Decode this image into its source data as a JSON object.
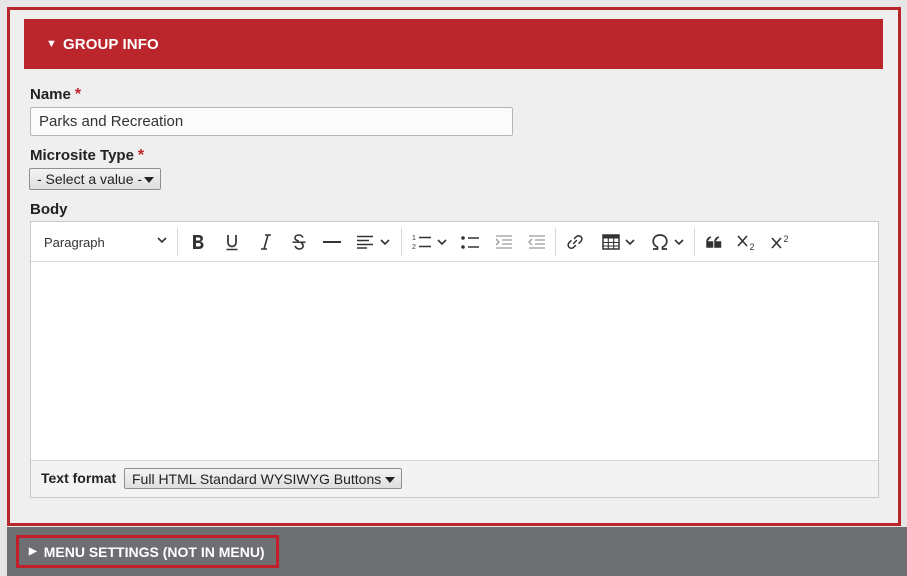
{
  "group_info": {
    "toggle_icon": "triangle-down",
    "title": "GROUP INFO"
  },
  "name_field": {
    "label": "Name",
    "required_mark": "*",
    "value": "Parks and Recreation"
  },
  "microsite_type": {
    "label": "Microsite Type",
    "required_mark": "*",
    "selected": "- Select a value -"
  },
  "body_field": {
    "label": "Body",
    "toolbar": {
      "heading_dropdown": "Paragraph",
      "buttons": [
        "bold",
        "underline",
        "italic",
        "strikethrough",
        "horizontal-line",
        "align",
        "numbered-list",
        "bulleted-list",
        "indent",
        "outdent",
        "link",
        "table",
        "special-characters",
        "blockquote",
        "subscript",
        "superscript"
      ]
    },
    "content": ""
  },
  "text_format": {
    "label": "Text format",
    "selected": "Full HTML Standard WYSIWYG Buttons"
  },
  "menu_settings": {
    "toggle_icon": "triangle-right",
    "title": "MENU SETTINGS (NOT IN MENU)"
  },
  "colors": {
    "accent_red": "#bb262d",
    "menu_bar_gray": "#6e6f72"
  }
}
